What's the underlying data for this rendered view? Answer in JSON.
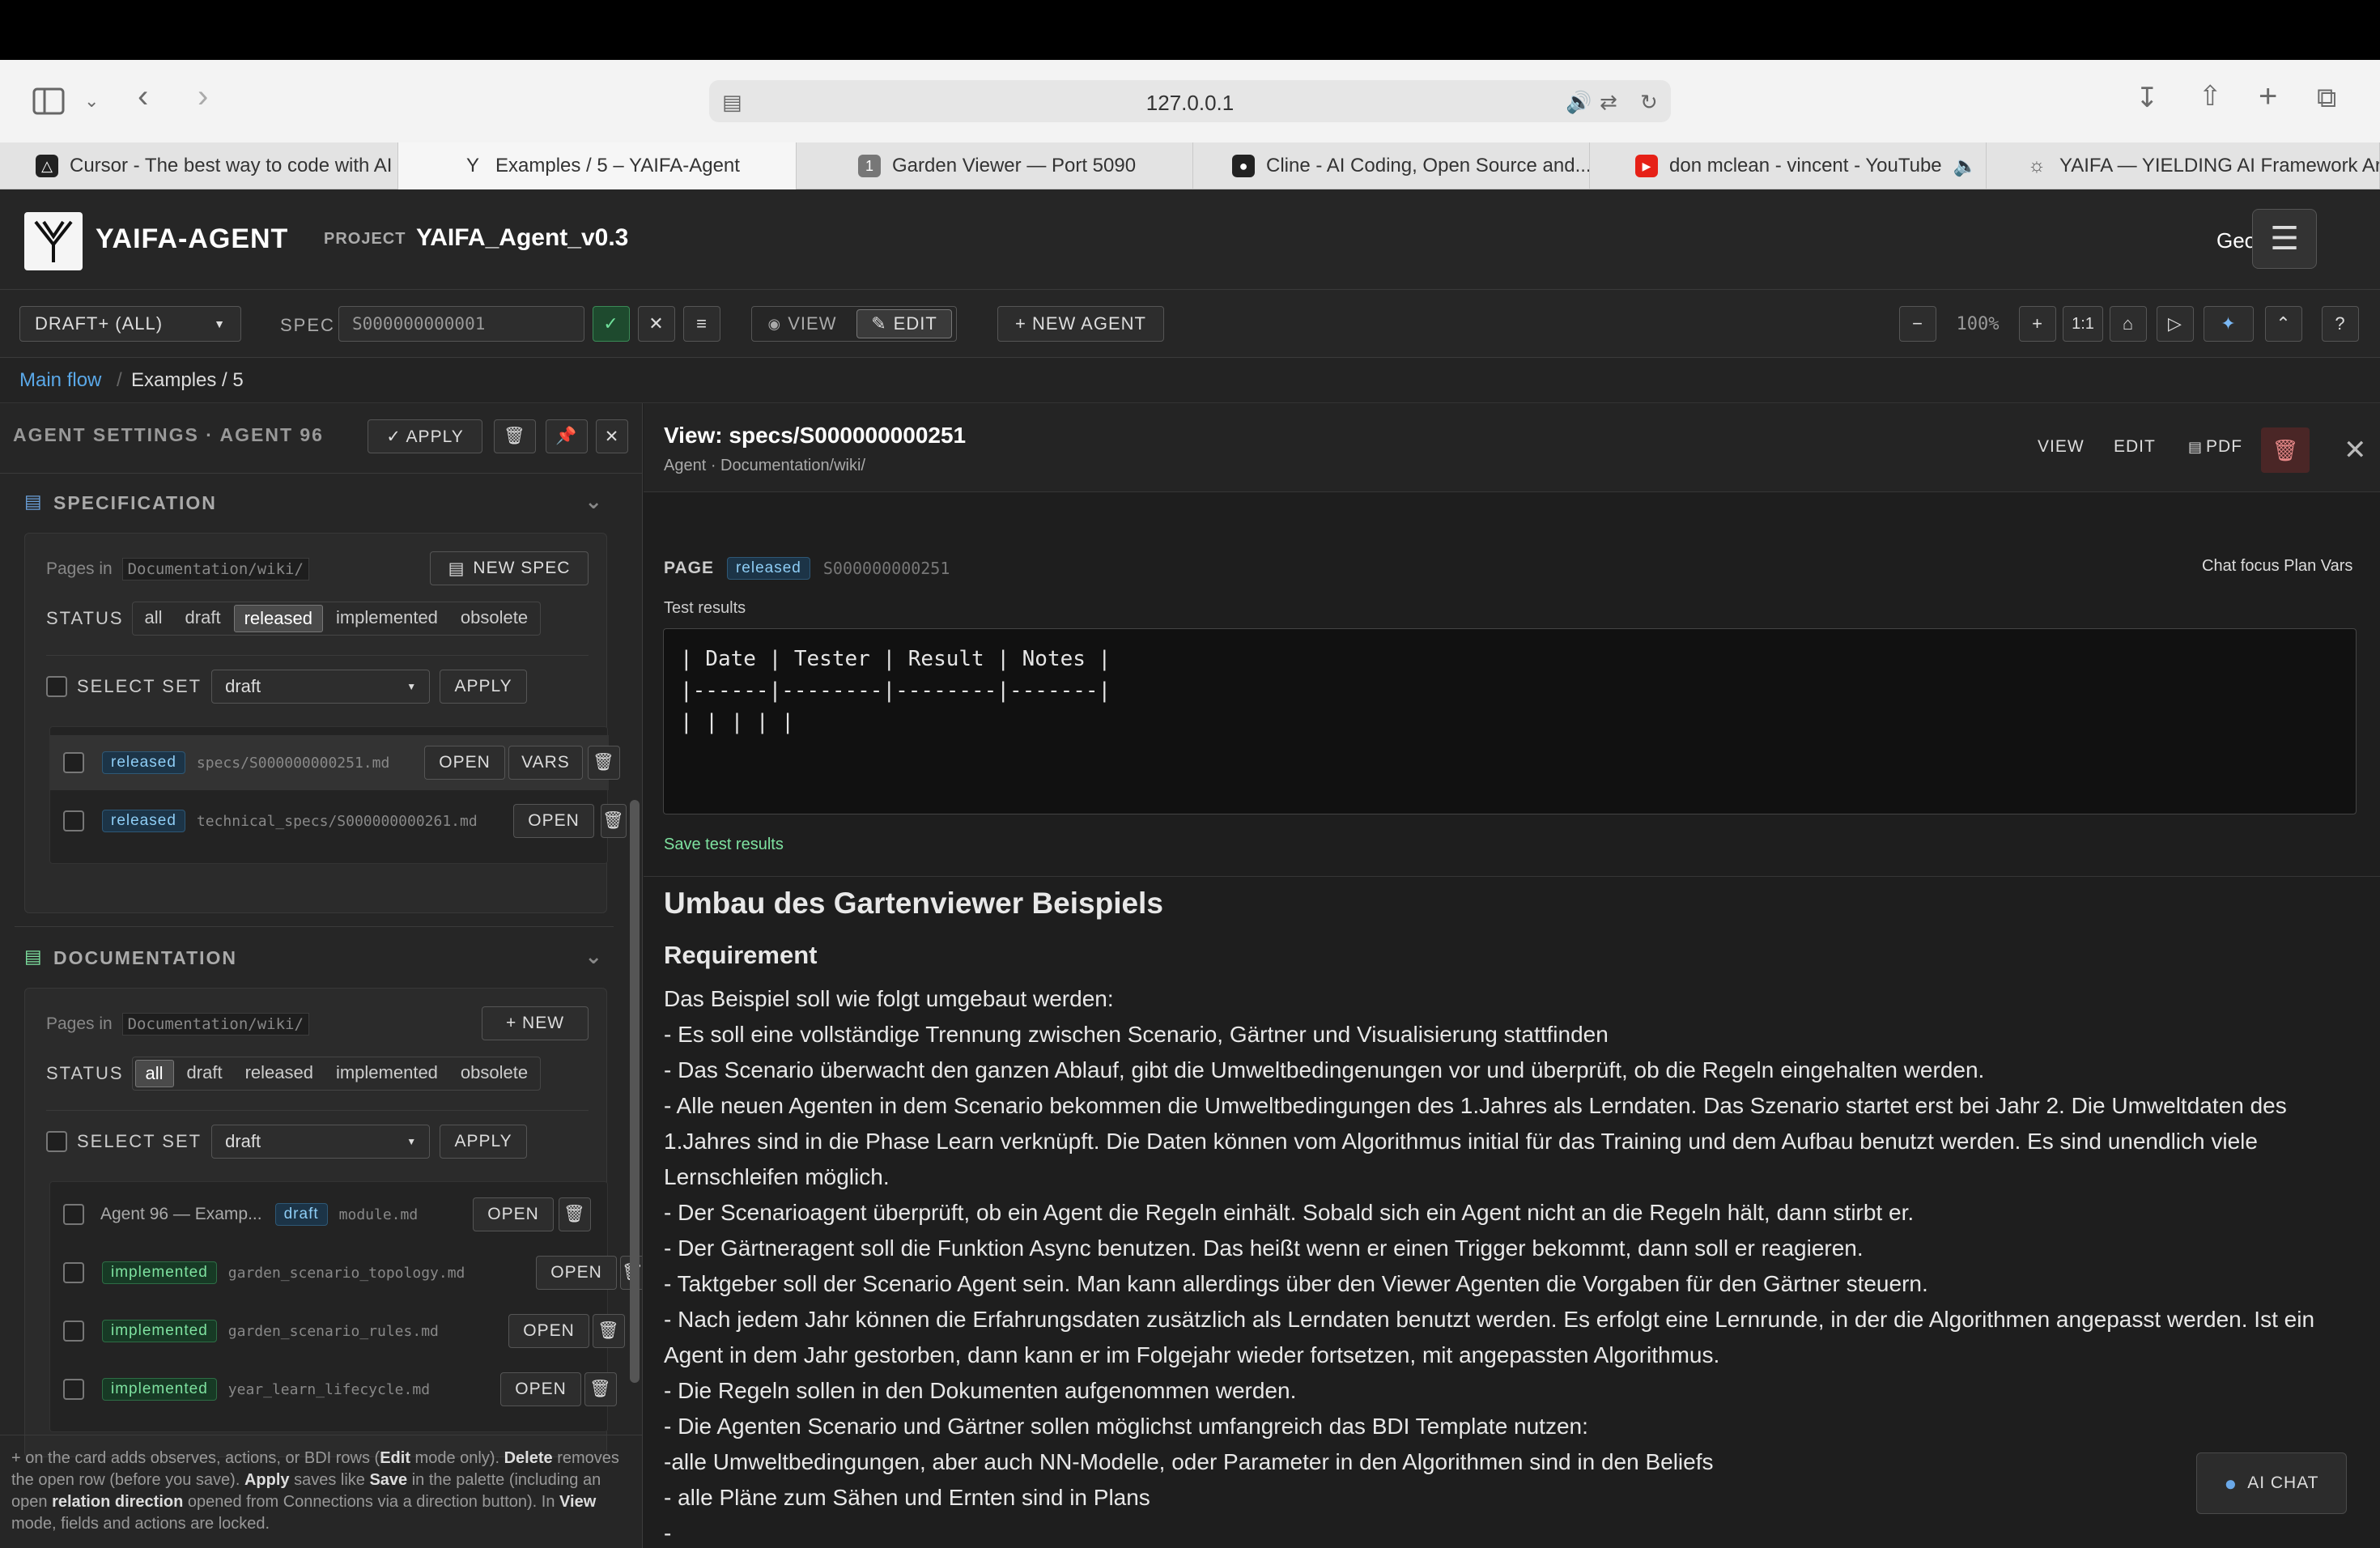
{
  "browser": {
    "url": "127.0.0.1",
    "tabs": [
      {
        "label": "Cursor - The best way to code with AI",
        "icon": "cursor-favicon"
      },
      {
        "label": "Examples / 5 – YAIFA-Agent",
        "icon": "yaifa-favicon"
      },
      {
        "label": "Garden Viewer — Port 5090",
        "icon": "number-1-favicon"
      },
      {
        "label": "Cline - AI Coding, Open Source and...",
        "icon": "cline-favicon"
      },
      {
        "label": "don mclean - vincent - YouTube",
        "icon": "youtube-favicon"
      },
      {
        "label": "YAIFA — YIELDING AI Framework Ar...",
        "icon": "compass-favicon"
      }
    ]
  },
  "header": {
    "brand": "YAIFA-AGENT",
    "project_label": "PROJECT",
    "project_name": "YAIFA_Agent_v0.3",
    "user": "Georg"
  },
  "toolbar": {
    "filter": "DRAFT+ (ALL)",
    "spec_label": "SPEC",
    "spec_value": "S000000000001",
    "view_label": "VIEW",
    "edit_label": "EDIT",
    "new_agent_label": "+ NEW AGENT",
    "zoom_out": "−",
    "zoom": "100%",
    "zoom_in": "+",
    "one_to_one": "1:1",
    "help": "?"
  },
  "breadcrumb": {
    "root": "Main flow",
    "sep": "/",
    "current": "Examples / 5"
  },
  "left": {
    "title": "AGENT SETTINGS · AGENT 96",
    "apply": "✓ APPLY",
    "spec_section": {
      "title": "SPECIFICATION",
      "pages_in": "Pages in",
      "path": "Documentation/wiki/",
      "new_btn": "NEW SPEC",
      "status_label": "STATUS",
      "statuses": [
        "all",
        "draft",
        "released",
        "implemented",
        "obsolete"
      ],
      "select_set": "SELECT SET",
      "select_value": "draft",
      "apply": "APPLY",
      "rows": [
        {
          "badge": "released",
          "file": "specs/S000000000251.md",
          "open": "OPEN",
          "vars": "VARS"
        },
        {
          "badge": "released",
          "file": "technical_specs/S000000000261.md",
          "open": "OPEN"
        }
      ]
    },
    "doc_section": {
      "title": "DOCUMENTATION",
      "pages_in": "Pages in",
      "path": "Documentation/wiki/",
      "new_btn": "+ NEW",
      "status_label": "STATUS",
      "statuses": [
        "all",
        "draft",
        "released",
        "implemented",
        "obsolete"
      ],
      "select_set": "SELECT SET",
      "select_value": "draft",
      "apply": "APPLY",
      "rows": [
        {
          "name": "Agent 96 — Examp...",
          "badge": "draft",
          "file": "module.md",
          "open": "OPEN"
        },
        {
          "badge": "implemented",
          "file": "garden_scenario_topology.md",
          "open": "OPEN"
        },
        {
          "badge": "implemented",
          "file": "garden_scenario_rules.md",
          "open": "OPEN"
        },
        {
          "badge": "implemented",
          "file": "year_learn_lifecycle.md",
          "open": "OPEN"
        }
      ]
    },
    "help": {
      "p1": "+ on the card adds observes, actions, or BDI rows (",
      "edit": "Edit",
      "p2": " mode only). ",
      "delete": "Delete",
      "p3": " removes the open row (before you save). ",
      "apply": "Apply",
      "p4": " saves like ",
      "save": "Save",
      "p5": " in the palette (including an open ",
      "reldir": "relation direction",
      "p6": " opened from Connections via a direction button). In ",
      "view": "View",
      "p7": " mode, fields and actions are locked."
    }
  },
  "right": {
    "title": "View: specs/S000000000251",
    "subtitle": "Agent · Documentation/wiki/",
    "view": "VIEW",
    "edit": "EDIT",
    "pdf": "PDF",
    "page_label": "PAGE",
    "badge": "released",
    "page_id": "S000000000251",
    "links": "Chat focus Plan Vars",
    "test_results_label": "Test results",
    "test_results": "| Date | Tester | Result | Notes |\n|------|--------|--------|-------|\n| | | | |",
    "save_link": "Save test results",
    "doc_title": "Umbau des Gartenviewer Beispiels",
    "req_heading": "Requirement",
    "lines": [
      "Das Beispiel soll wie folgt umgebaut werden:",
      "- Es soll eine vollständige Trennung zwischen Scenario, Gärtner und Visualisierung stattfinden",
      "- Das Scenario überwacht den ganzen Ablauf, gibt die Umweltbedingenungen vor und überprüft, ob die Regeln eingehalten werden.",
      "- Alle neuen Agenten in dem Scenario bekommen die Umweltbedingungen des 1.Jahres als Lerndaten. Das Szenario startet erst bei Jahr 2. Die Umweltdaten des 1.Jahres sind in die Phase Learn verknüpft. Die Daten können vom Algorithmus initial für das Training und dem Aufbau benutzt werden. Es sind unendlich viele Lernschleifen möglich.",
      "- Der Scenarioagent überprüft, ob ein Agent die Regeln einhält. Sobald sich ein Agent nicht an die Regeln hält, dann stirbt er.",
      "- Der Gärtneragent soll die Funktion Async benutzen. Das heißt wenn er einen Trigger bekommt, dann soll er reagieren.",
      "- Taktgeber soll der Scenario Agent sein. Man kann allerdings über den Viewer Agenten die Vorgaben für den Gärtner steuern.",
      "- Nach jedem Jahr können die Erfahrungsdaten zusätzlich als Lerndaten benutzt werden. Es erfolgt eine Lernrunde, in der die Algorithmen angepasst werden. Ist ein Agent in dem Jahr gestorben, dann kann er im Folgejahr wieder fortsetzen, mit angepassten Algorithmus.",
      "- Die Regeln sollen in den Dokumenten aufgenommen werden.",
      "- Die Agenten Scenario und Gärtner sollen möglichst umfangreich das BDI Template nutzen:",
      "-alle Umweltbedingungen, aber auch NN-Modelle, oder Parameter in den Algorithmen sind in den Beliefs",
      "- alle Pläne zum Sähen und Ernten sind in Plans",
      "-"
    ],
    "ai_chat": "AI CHAT"
  }
}
